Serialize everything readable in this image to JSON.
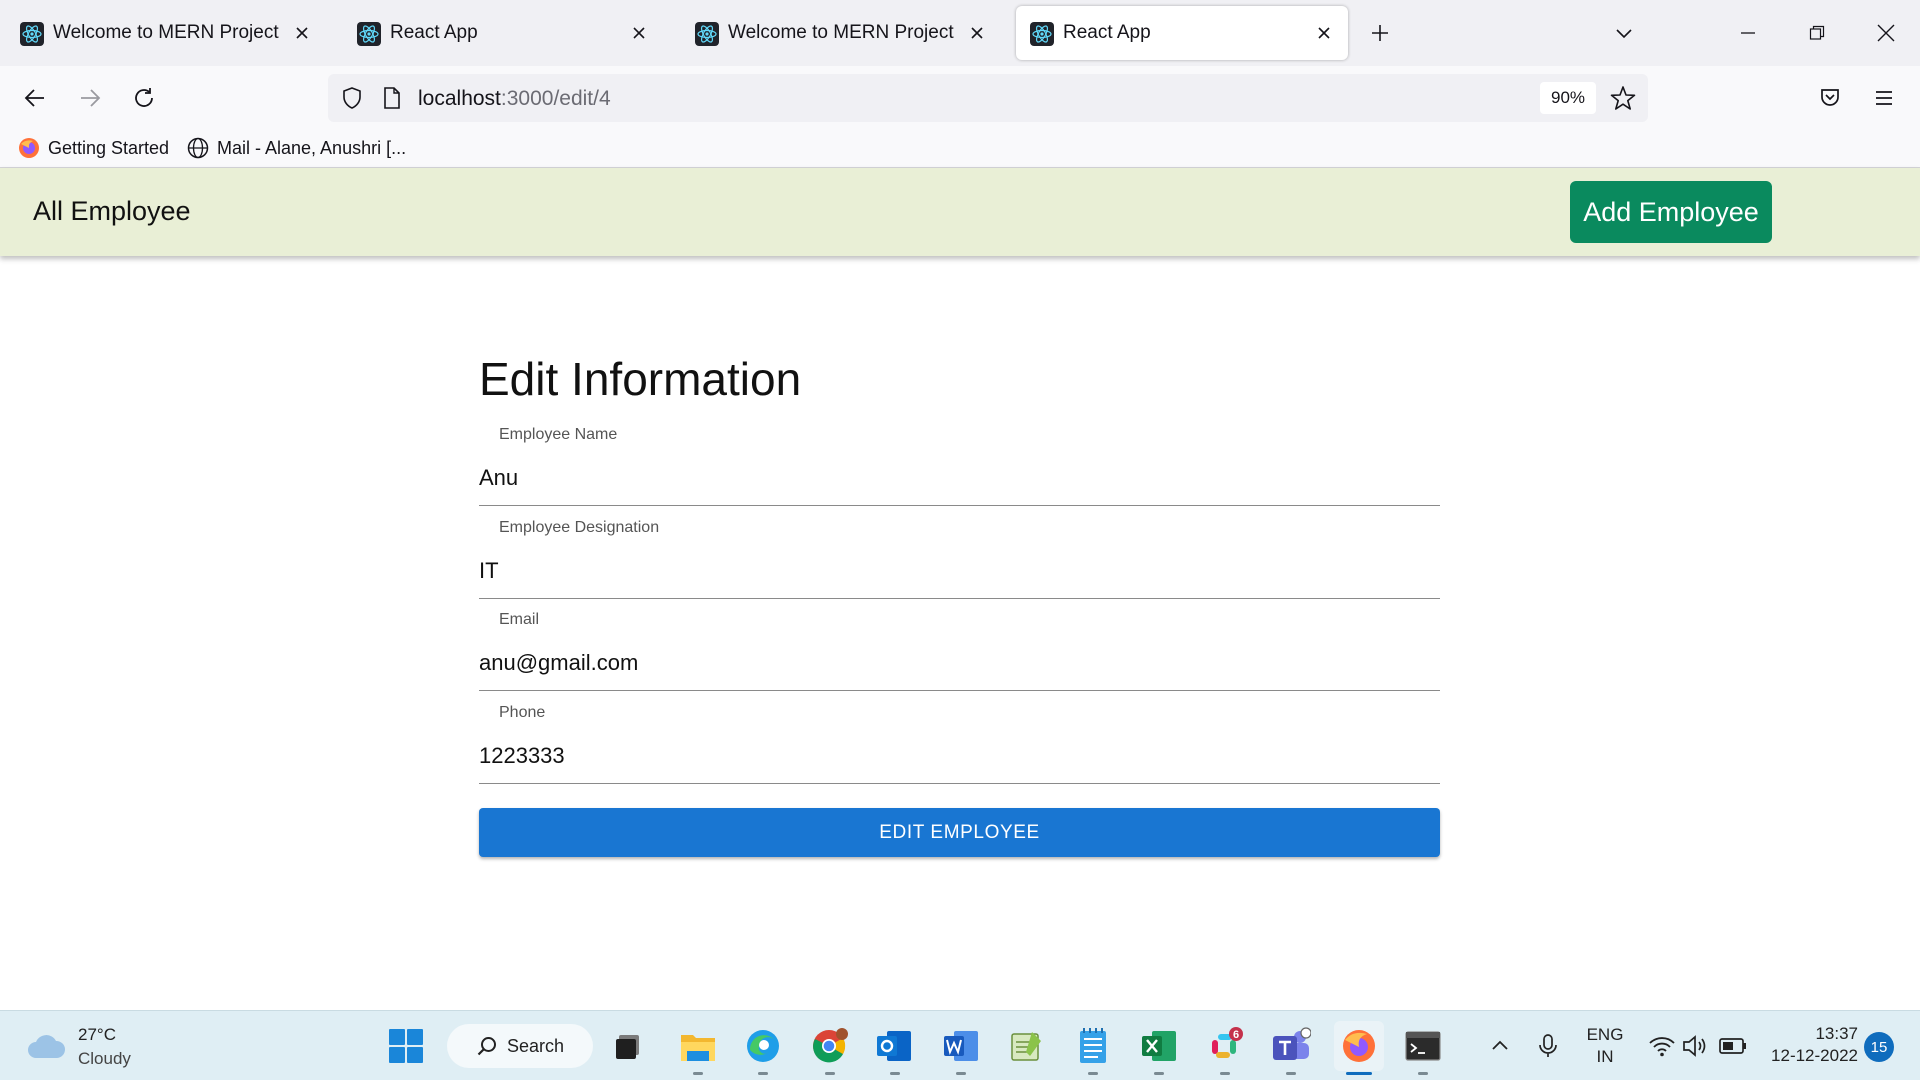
{
  "browser": {
    "tabs": [
      {
        "title": "Welcome to MERN Project",
        "active": false
      },
      {
        "title": "React App",
        "active": false
      },
      {
        "title": "Welcome to MERN Project",
        "active": false
      },
      {
        "title": "React App",
        "active": true
      }
    ],
    "url_host": "localhost",
    "url_path": ":3000/edit/4",
    "zoom": "90%",
    "bookmarks": [
      {
        "label": "Getting Started",
        "icon": "firefox-icon"
      },
      {
        "label": "Mail - Alane, Anushri [...",
        "icon": "globe-icon"
      }
    ]
  },
  "app": {
    "nav_link": "All Employee",
    "add_button": "Add Employee",
    "form": {
      "title": "Edit Information",
      "fields": [
        {
          "label": "Employee Name",
          "value": "Anu"
        },
        {
          "label": "Employee Designation",
          "value": "IT"
        },
        {
          "label": "Email",
          "value": "anu@gmail.com"
        },
        {
          "label": "Phone",
          "value": "1223333"
        }
      ],
      "submit_label": "EDIT EMPLOYEE"
    },
    "colors": {
      "header_bg": "#e9efd6",
      "add_button_bg": "#0a8a5e",
      "submit_bg": "#1976d2"
    }
  },
  "taskbar": {
    "weather_temp": "27°C",
    "weather_desc": "Cloudy",
    "search_label": "Search",
    "apps": [
      "start-icon",
      "search-icon",
      "task-view-icon",
      "file-explorer-icon",
      "edge-icon",
      "chrome-icon",
      "outlook-icon",
      "word-icon",
      "notepad-plus-plus-icon",
      "notepad-icon",
      "excel-icon",
      "slack-icon",
      "teams-icon",
      "firefox-icon",
      "terminal-icon"
    ],
    "slack_badge": "6",
    "language_line1": "ENG",
    "language_line2": "IN",
    "time": "13:37",
    "date": "12-12-2022",
    "notifications": "15"
  }
}
